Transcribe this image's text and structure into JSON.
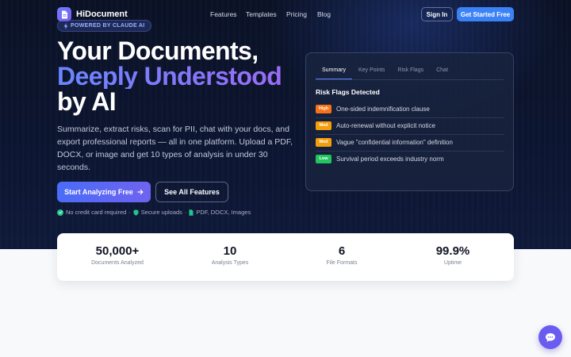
{
  "brand": {
    "name": "HiDocument",
    "powered": "POWERED BY CLAUDE AI"
  },
  "nav": {
    "items": [
      "Features",
      "Templates",
      "Pricing",
      "Blog"
    ],
    "sign_in": "Sign In",
    "get_started": "Get Started Free"
  },
  "hero": {
    "line1": "Your Documents,",
    "line2": "Deeply Understood",
    "line3": "by AI",
    "description": "Summarize, extract risks, scan for PII, chat with your docs, and export professional reports — all in one platform. Upload a PDF, DOCX, or image and get 10 types of analysis in under 30 seconds.",
    "cta_primary": "Start Analyzing Free",
    "cta_secondary": "See All Features",
    "trust": [
      "No credit card required",
      "Secure uploads",
      "PDF, DOCX, Images"
    ]
  },
  "panel": {
    "tabs": [
      "Summary",
      "Key Points",
      "Risk Flags",
      "Chat"
    ],
    "active_tab": "Summary",
    "title": "Risk Flags Detected",
    "flags": [
      {
        "level": "High",
        "text": "One-sided indemnification clause",
        "color": "#f97316"
      },
      {
        "level": "Med",
        "text": "Auto-renewal without explicit notice",
        "color": "#f59e0b"
      },
      {
        "level": "Med",
        "text": "Vague \"confidential information\" definition",
        "color": "#f59e0b"
      },
      {
        "level": "Low",
        "text": "Survival period exceeds industry norm",
        "color": "#22c55e"
      }
    ]
  },
  "stats": [
    {
      "value": "50,000+",
      "label": "Documents Analyzed"
    },
    {
      "value": "10",
      "label": "Analysis Types"
    },
    {
      "value": "6",
      "label": "File Formats"
    },
    {
      "value": "99.9%",
      "label": "Uptime"
    }
  ],
  "colors": {
    "accent": "#3b82f6",
    "brand": "#6d7cff",
    "hero_bg": "#0c1530"
  },
  "icons": {
    "logo": "document-icon",
    "powered": "lightning-icon",
    "chat": "chat-icon"
  }
}
